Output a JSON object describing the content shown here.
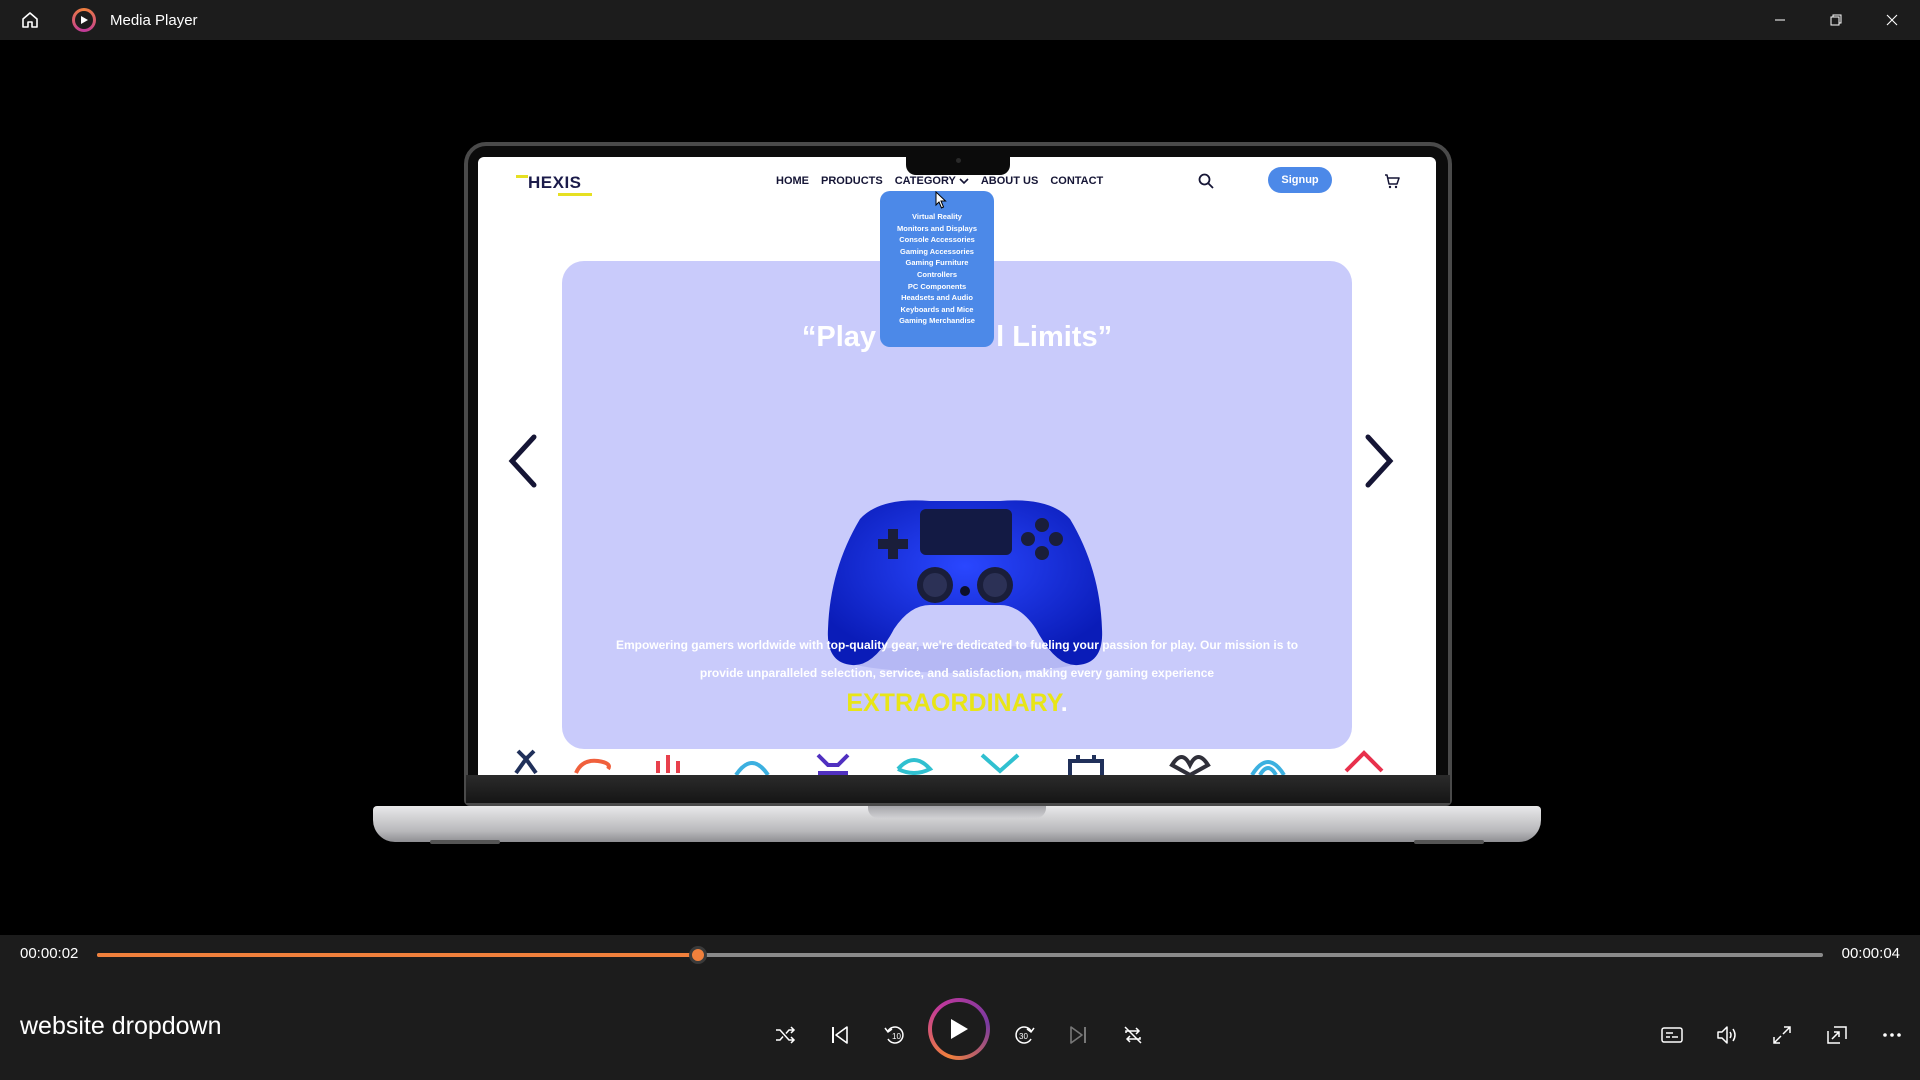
{
  "app": {
    "title": "Media Player"
  },
  "window_controls": {
    "minimize": "minimize-icon",
    "restore": "restore-icon",
    "close": "close-icon"
  },
  "website": {
    "logo": "HEXIS",
    "nav": {
      "home": "HOME",
      "products": "PRODUCTS",
      "category": "CATEGORY",
      "about": "ABOUT US",
      "contact": "CONTACT"
    },
    "signup": "Signup",
    "dropdown": [
      "Virtual Reality",
      "Monitors and Displays",
      "Console Accessories",
      "Gaming Accessories",
      "Gaming Furniture",
      "Controllers",
      "PC Components",
      "Headsets and Audio",
      "Keyboards and Mice",
      "Gaming Merchandise"
    ],
    "hero": {
      "title": "“Play",
      "title_end": "l Limits”",
      "text_line1": "Empowering gamers worldwide with top-quality gear, we're dedicated to fueling your passion for play. Our mission is to",
      "text_line2": "provide unparalleled selection, service, and satisfaction, making every gaming experience",
      "emphasis": "EXTRAORDINARY",
      "emphasis_end": "."
    },
    "accent_color": "#4c89e8",
    "highlight_color": "#e8e517"
  },
  "player": {
    "current_time": "00:00:02",
    "total_time": "00:00:04",
    "progress": 0.348,
    "media_title": "website dropdown",
    "accent_color": "#f0803c"
  }
}
